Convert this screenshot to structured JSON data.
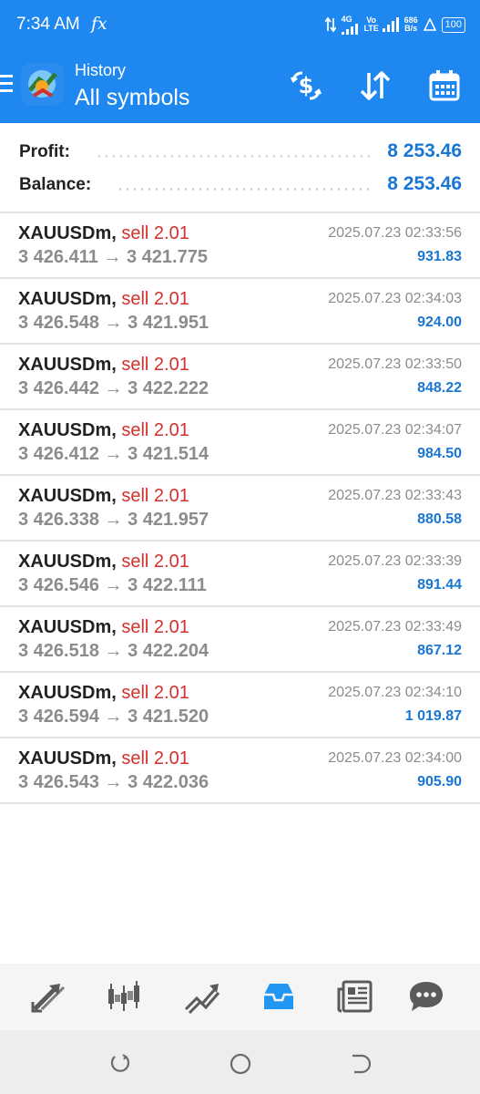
{
  "status_bar": {
    "time": "7:34 AM",
    "fx": "fx",
    "net_4g": "4G",
    "volte": "Vo LTE",
    "speed_value": "686",
    "speed_unit": "B/s",
    "battery": "100"
  },
  "header": {
    "subtitle": "History",
    "title": "All symbols",
    "icons": [
      "dollar-refresh-icon",
      "sort-icon",
      "calendar-icon"
    ]
  },
  "summary": {
    "profit_label": "Profit:",
    "profit_value": "8 253.46",
    "balance_label": "Balance:",
    "balance_value": "8 253.46"
  },
  "trades": [
    {
      "symbol": "XAUUSDm,",
      "side": "sell 2.01",
      "open": "3 426.411",
      "arrow": "→",
      "close": "3 421.775",
      "time": "2025.07.23 02:33:56",
      "profit": "931.83"
    },
    {
      "symbol": "XAUUSDm,",
      "side": "sell 2.01",
      "open": "3 426.548",
      "arrow": "→",
      "close": "3 421.951",
      "time": "2025.07.23 02:34:03",
      "profit": "924.00"
    },
    {
      "symbol": "XAUUSDm,",
      "side": "sell 2.01",
      "open": "3 426.442",
      "arrow": "→",
      "close": "3 422.222",
      "time": "2025.07.23 02:33:50",
      "profit": "848.22"
    },
    {
      "symbol": "XAUUSDm,",
      "side": "sell 2.01",
      "open": "3 426.412",
      "arrow": "→",
      "close": "3 421.514",
      "time": "2025.07.23 02:34:07",
      "profit": "984.50"
    },
    {
      "symbol": "XAUUSDm,",
      "side": "sell 2.01",
      "open": "3 426.338",
      "arrow": "→",
      "close": "3 421.957",
      "time": "2025.07.23 02:33:43",
      "profit": "880.58"
    },
    {
      "symbol": "XAUUSDm,",
      "side": "sell 2.01",
      "open": "3 426.546",
      "arrow": "→",
      "close": "3 422.111",
      "time": "2025.07.23 02:33:39",
      "profit": "891.44"
    },
    {
      "symbol": "XAUUSDm,",
      "side": "sell 2.01",
      "open": "3 426.518",
      "arrow": "→",
      "close": "3 422.204",
      "time": "2025.07.23 02:33:49",
      "profit": "867.12"
    },
    {
      "symbol": "XAUUSDm,",
      "side": "sell 2.01",
      "open": "3 426.594",
      "arrow": "→",
      "close": "3 421.520",
      "time": "2025.07.23 02:34:10",
      "profit": "1 019.87"
    },
    {
      "symbol": "XAUUSDm,",
      "side": "sell 2.01",
      "open": "3 426.543",
      "arrow": "→",
      "close": "3 422.036",
      "time": "2025.07.23 02:34:00",
      "profit": "905.90"
    }
  ],
  "bottom_nav": {
    "items": [
      "quotes-icon",
      "chart-icon",
      "trade-icon",
      "history-icon",
      "news-icon",
      "messages-icon"
    ],
    "active": "history-icon"
  },
  "system_nav": [
    "recents-icon",
    "home-icon",
    "back-icon"
  ],
  "colors": {
    "header_bg": "#1e88f0",
    "accent_blue": "#1976d2",
    "sell_red": "#d32f2f",
    "muted_gray": "#8c8c8c",
    "active_nav": "#2196f3"
  }
}
